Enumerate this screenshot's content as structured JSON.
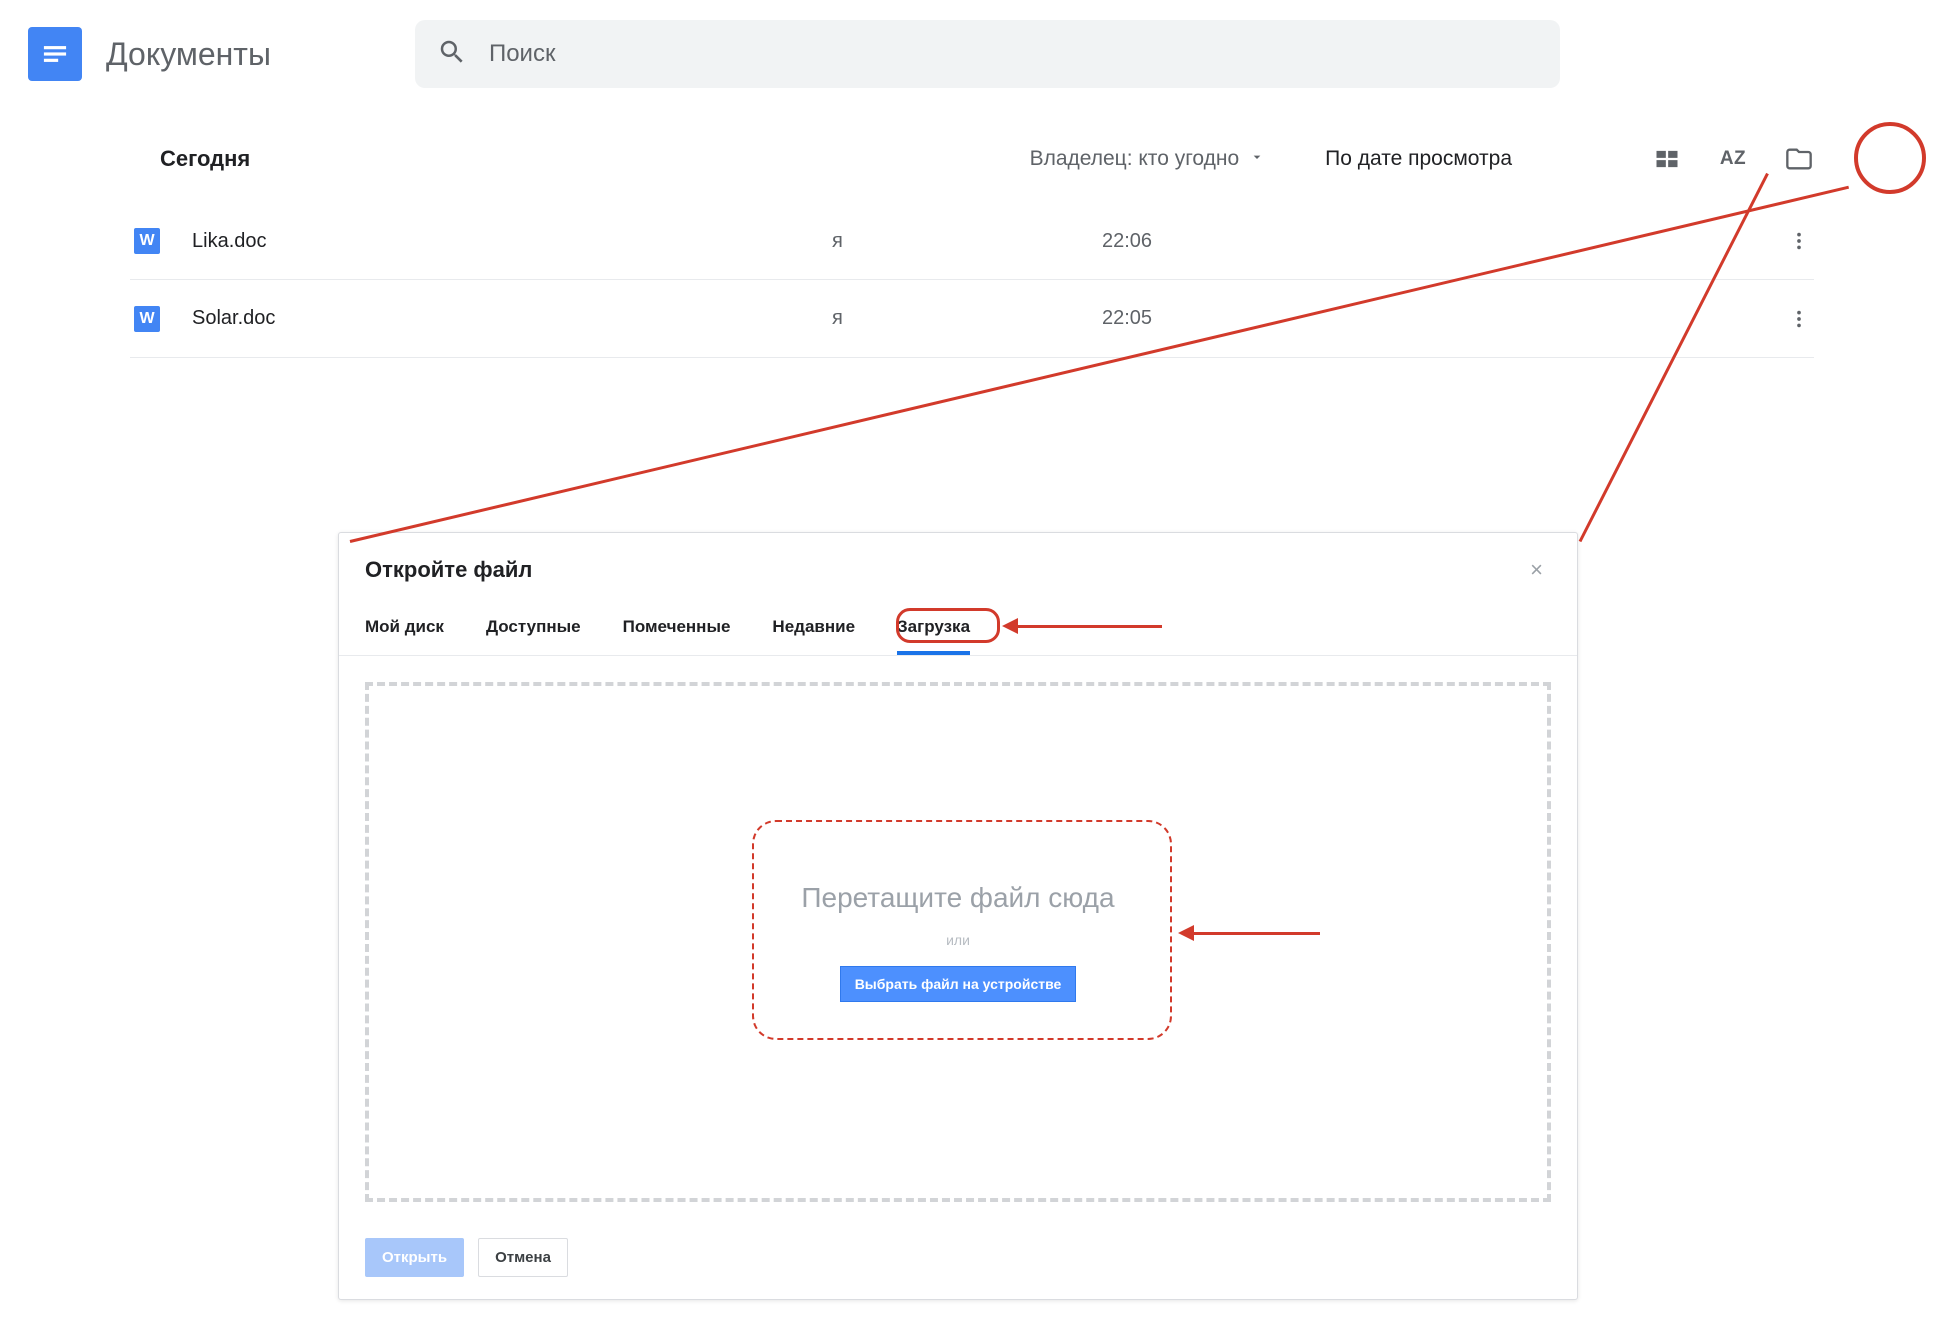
{
  "app": {
    "title": "Документы",
    "search_placeholder": "Поиск"
  },
  "filters": {
    "section_heading": "Сегодня",
    "owner_dropdown": "Владелец: кто угодно",
    "sort_label": "По дате просмотра",
    "az_icon_text": "AZ"
  },
  "files": [
    {
      "icon_letter": "W",
      "name": "Lika.doc",
      "owner": "я",
      "time": "22:06"
    },
    {
      "icon_letter": "W",
      "name": "Solar.doc",
      "owner": "я",
      "time": "22:05"
    }
  ],
  "dialog": {
    "title": "Откройте файл",
    "tabs": [
      "Мой диск",
      "Доступные",
      "Помеченные",
      "Недавние",
      "Загрузка"
    ],
    "active_tab_index": 4,
    "drop_title": "Перетащите файл сюда",
    "drop_or": "или",
    "select_file_btn": "Выбрать файл на устройстве",
    "footer_open": "Открыть",
    "footer_cancel": "Отмена",
    "close_glyph": "×"
  }
}
